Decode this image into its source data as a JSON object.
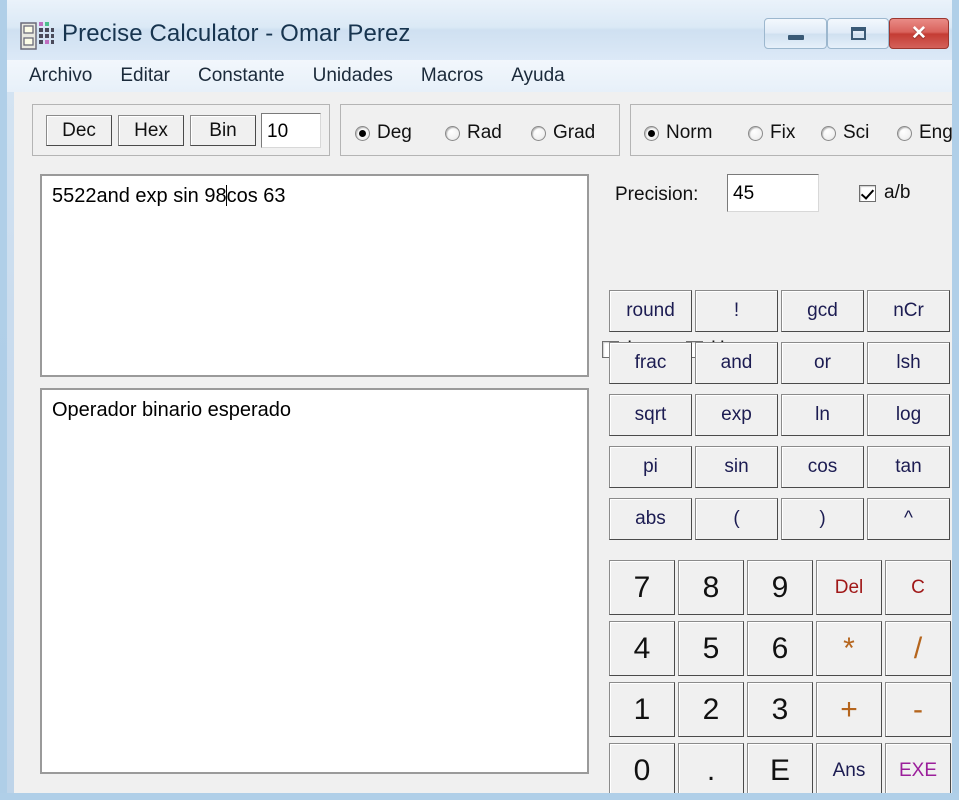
{
  "window": {
    "title": "Precise Calculator - Omar Perez",
    "icon": "calculator-icon",
    "controls": {
      "minimize": "minimize-icon",
      "maximize": "restore-icon",
      "close": "✕"
    },
    "colors": {
      "frame": "#aecee7",
      "titlebar_gradient_top": "#eaf2fa",
      "close_button": "#c43c34",
      "client_bg": "#f0f0f0",
      "button_text_navy": "#1c1c52",
      "del_clear_text": "#a01818",
      "operator_text": "#b5651d",
      "exe_text": "#9b1f9b"
    }
  },
  "menu": {
    "items": [
      "Archivo",
      "Editar",
      "Constante",
      "Unidades",
      "Macros",
      "Ayuda"
    ]
  },
  "toolbar": {
    "base_buttons": [
      "Dec",
      "Hex",
      "Bin"
    ],
    "base_value": "10",
    "angle_mode": {
      "options": [
        "Deg",
        "Rad",
        "Grad"
      ],
      "selected": "Deg"
    },
    "number_format": {
      "options": [
        "Norm",
        "Fix",
        "Sci",
        "Eng"
      ],
      "selected": "Norm"
    }
  },
  "editor": {
    "expression_before_caret": "5522and exp sin 98",
    "expression_after_caret": "cos 63",
    "expression_full": "5522and exp sin 98cos 63",
    "output": "Operador binario esperado"
  },
  "settings": {
    "precision_label": "Precision:",
    "precision_value": "45",
    "ab_label": "a/b",
    "ab_checked": true,
    "inv_label": "Inv",
    "inv_checked": false,
    "hyp_label": "Hyp",
    "hyp_checked": false
  },
  "function_keys": [
    [
      "round",
      "!",
      "gcd",
      "nCr"
    ],
    [
      "frac",
      "and",
      "or",
      "lsh"
    ],
    [
      "sqrt",
      "exp",
      "ln",
      "log"
    ],
    [
      "pi",
      "sin",
      "cos",
      "tan"
    ],
    [
      "abs",
      "(",
      ")",
      "^"
    ]
  ],
  "keypad": [
    [
      "7",
      "8",
      "9",
      "Del",
      "C"
    ],
    [
      "4",
      "5",
      "6",
      "*",
      "/"
    ],
    [
      "1",
      "2",
      "3",
      "+",
      "-"
    ],
    [
      "0",
      ".",
      "E",
      "Ans",
      "EXE"
    ]
  ]
}
